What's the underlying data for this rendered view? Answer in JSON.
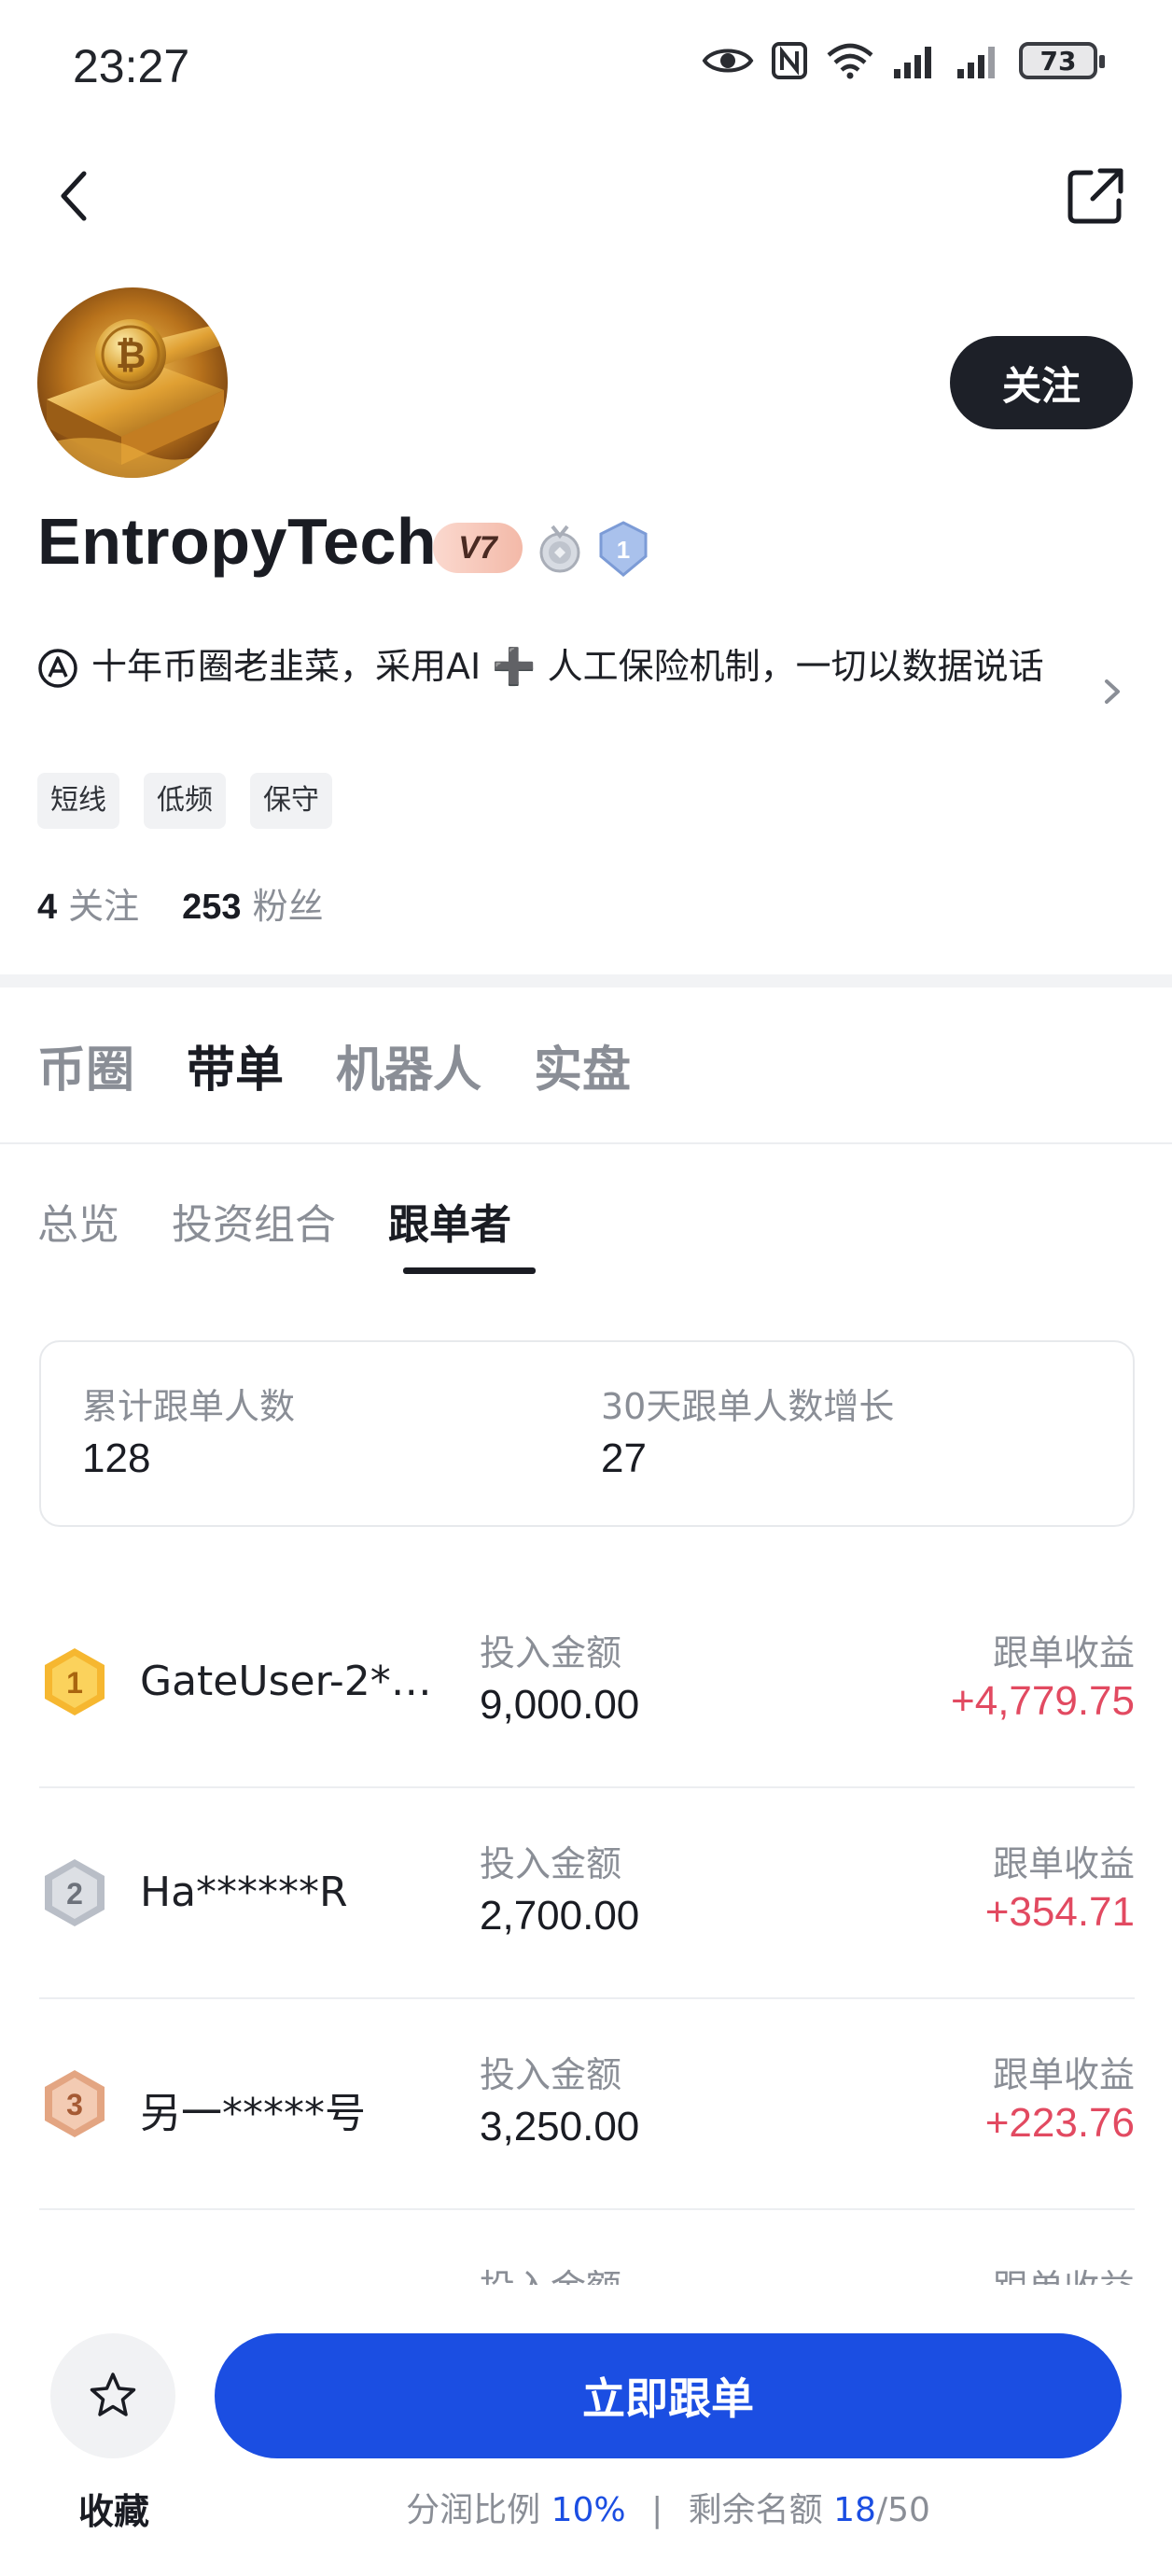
{
  "status_bar": {
    "time": "23:27",
    "battery": "73"
  },
  "profile": {
    "name": "EntropyTech",
    "vip_level": "V7",
    "level_number": "1",
    "follow_label": "关注",
    "bio": "十年币圈老韭菜，采用AI ➕ 人工保险机制，一切以数据说话",
    "tags": [
      "短线",
      "低频",
      "保守"
    ],
    "following_count": "4",
    "following_label": "关注",
    "followers_count": "253",
    "followers_label": "粉丝"
  },
  "main_tabs": [
    {
      "label": "币圈",
      "active": false
    },
    {
      "label": "带单",
      "active": true
    },
    {
      "label": "机器人",
      "active": false
    },
    {
      "label": "实盘",
      "active": false
    }
  ],
  "sub_tabs": [
    {
      "label": "总览",
      "active": false
    },
    {
      "label": "投资组合",
      "active": false
    },
    {
      "label": "跟单者",
      "active": true
    }
  ],
  "summary": {
    "total_label": "累计跟单人数",
    "total_value": "128",
    "growth_label": "30天跟单人数增长",
    "growth_value": "27"
  },
  "followers": [
    {
      "rank": "1",
      "name": "GateUser-2*…",
      "amount_label": "投入金额",
      "amount": "9,000.00",
      "profit_label": "跟单收益",
      "profit": "+4,779.75"
    },
    {
      "rank": "2",
      "name": "Ha******R",
      "amount_label": "投入金额",
      "amount": "2,700.00",
      "profit_label": "跟单收益",
      "profit": "+354.71"
    },
    {
      "rank": "3",
      "name": "另一*****号",
      "amount_label": "投入金额",
      "amount": "3,250.00",
      "profit_label": "跟单收益",
      "profit": "+223.76"
    },
    {
      "amount_label": "投入金额",
      "profit_label": "跟单收益"
    }
  ],
  "bottom": {
    "favorite_label": "收藏",
    "copy_button": "立即跟单",
    "share_ratio_label": "分润比例",
    "share_ratio_value": "10%",
    "separator": "|",
    "remaining_label": "剩余名额",
    "remaining_value": "18",
    "remaining_total": "/50"
  },
  "colors": {
    "accent": "#1b4ee2",
    "profit": "#e24a61",
    "dark_button": "#1d2028"
  }
}
